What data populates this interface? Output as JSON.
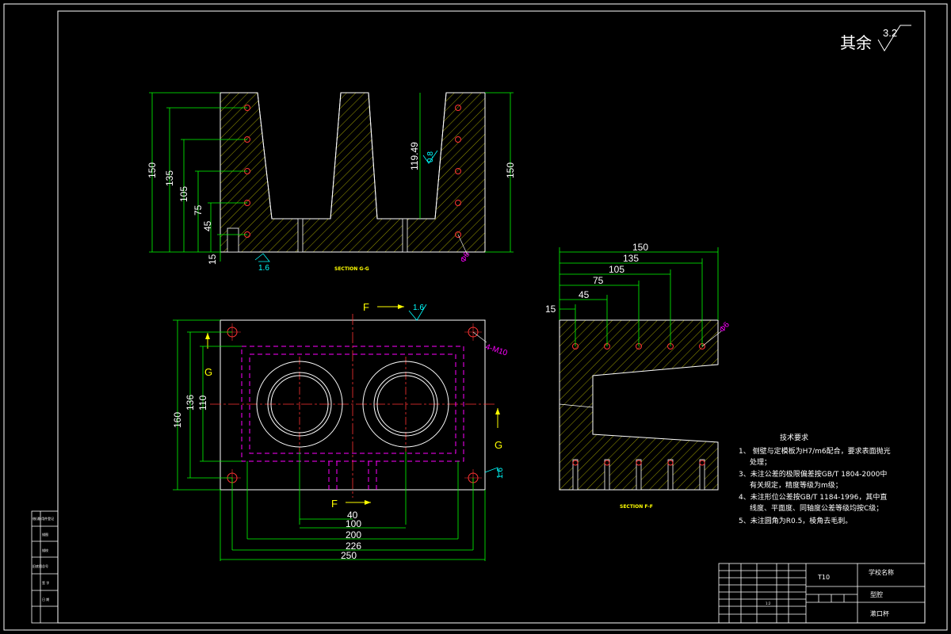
{
  "roughness_other": {
    "label": "其余",
    "value": "3.2"
  },
  "section_gg": {
    "caption": "SECTION G-G",
    "dims_left": [
      "150",
      "135",
      "105",
      "75",
      "45",
      "15"
    ],
    "dim_right": "150",
    "dim_depth": "119.49",
    "rough_inner": "0.8",
    "rough_bottom": "1.6",
    "hole_label": "Φ6"
  },
  "plan_view": {
    "cut_label_f": "F",
    "cut_label_g": "G",
    "rough_top": "1.6",
    "rough_right": "1.6",
    "thread_label": "4-M10",
    "dim_h_total": "160",
    "dim_h_136": "136",
    "dim_h_110": "110",
    "dim_w": [
      "40",
      "100",
      "200",
      "226",
      "250"
    ]
  },
  "section_ff": {
    "caption": "SECTION F-F",
    "dims_top": [
      "150",
      "135",
      "105",
      "75",
      "45",
      "15"
    ],
    "hole_label": "Φ6"
  },
  "tech_req": {
    "title": "技术要求",
    "items": [
      "1、 侧壁与定模板为H7/m6配合，要求表面抛光",
      "处理；",
      "3、未注公差的极限偏差按GB/T 1804-2000中",
      "有关规定，精度等级为m级；",
      "4、未注形位公差按GB/T 1184-1996，其中直",
      "线度、平面度、同轴度公差等级均按C级；",
      "5、未注圆角为R0.5，棱角去毛刺。"
    ]
  },
  "title_block": {
    "material": "T10",
    "school": "学校名称",
    "part_type": "型腔",
    "part_name": "漱口杯",
    "scale": "1:2"
  },
  "side_block": {
    "rows": [
      "借(通)用件登记",
      "描图",
      "描校",
      "旧底图总号",
      "签 字",
      "日 期"
    ]
  }
}
